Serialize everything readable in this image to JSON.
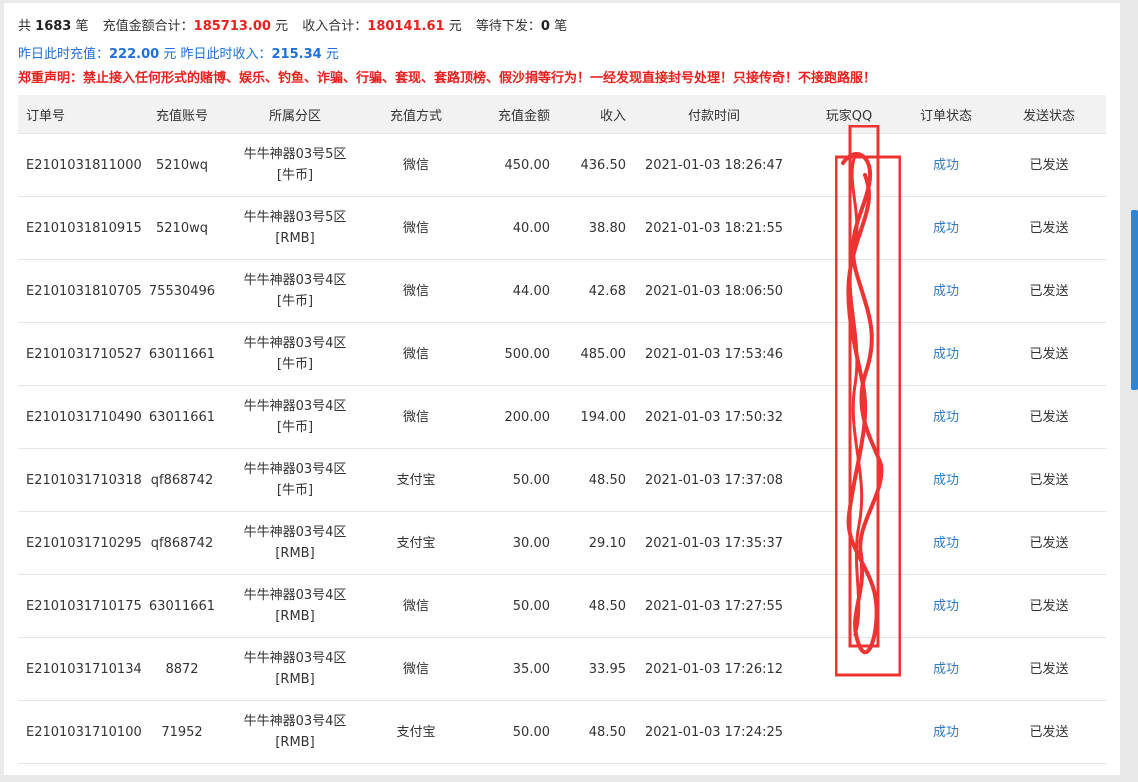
{
  "summary": {
    "total_prefix": "共",
    "total_count": "1683",
    "total_unit": "笔",
    "recharge_label": "充值金额合计：",
    "recharge_total": "185713.00",
    "recharge_unit": "元",
    "income_label": "收入合计：",
    "income_total": "180141.61",
    "income_unit": "元",
    "pending_label": "等待下发：",
    "pending_count": "0",
    "pending_unit": "笔"
  },
  "yesterday": {
    "recharge_label": "昨日此时充值：",
    "recharge_value": "222.00",
    "recharge_unit": "元",
    "income_label": "昨日此时收入：",
    "income_value": "215.34",
    "income_unit": "元"
  },
  "notice": "郑重声明：禁止接入任何形式的赌博、娱乐、钓鱼、诈骗、行骗、套现、套路顶榜、假沙捐等行为！一经发现直接封号处理！只接传奇！不接跑路服！",
  "table": {
    "headers": {
      "order": "订单号",
      "account": "充值账号",
      "zone": "所属分区",
      "method": "充值方式",
      "amount": "充值金额",
      "income": "收入",
      "paytime": "付款时间",
      "qq": "玩家QQ",
      "order_status": "订单状态",
      "send_status": "发送状态"
    },
    "rows": [
      {
        "order": "E2101031811000",
        "account": "5210wq",
        "zone": "牛牛神器03号5区[牛币]",
        "method": "微信",
        "amount": "450.00",
        "income": "436.50",
        "paytime": "2021-01-03 18:26:47",
        "qq": "",
        "order_status": "成功",
        "send_status": "已发送"
      },
      {
        "order": "E2101031810915",
        "account": "5210wq",
        "zone": "牛牛神器03号5区[RMB]",
        "method": "微信",
        "amount": "40.00",
        "income": "38.80",
        "paytime": "2021-01-03 18:21:55",
        "qq": "",
        "order_status": "成功",
        "send_status": "已发送"
      },
      {
        "order": "E2101031810705",
        "account": "75530496",
        "zone": "牛牛神器03号4区[牛币]",
        "method": "微信",
        "amount": "44.00",
        "income": "42.68",
        "paytime": "2021-01-03 18:06:50",
        "qq": "",
        "order_status": "成功",
        "send_status": "已发送"
      },
      {
        "order": "E2101031710527",
        "account": "63011661",
        "zone": "牛牛神器03号4区[牛币]",
        "method": "微信",
        "amount": "500.00",
        "income": "485.00",
        "paytime": "2021-01-03 17:53:46",
        "qq": "",
        "order_status": "成功",
        "send_status": "已发送"
      },
      {
        "order": "E2101031710490",
        "account": "63011661",
        "zone": "牛牛神器03号4区[牛币]",
        "method": "微信",
        "amount": "200.00",
        "income": "194.00",
        "paytime": "2021-01-03 17:50:32",
        "qq": "",
        "order_status": "成功",
        "send_status": "已发送"
      },
      {
        "order": "E2101031710318",
        "account": "qf868742",
        "zone": "牛牛神器03号4区[牛币]",
        "method": "支付宝",
        "amount": "50.00",
        "income": "48.50",
        "paytime": "2021-01-03 17:37:08",
        "qq": "",
        "order_status": "成功",
        "send_status": "已发送"
      },
      {
        "order": "E2101031710295",
        "account": "qf868742",
        "zone": "牛牛神器03号4区[RMB]",
        "method": "支付宝",
        "amount": "30.00",
        "income": "29.10",
        "paytime": "2021-01-03 17:35:37",
        "qq": "",
        "order_status": "成功",
        "send_status": "已发送"
      },
      {
        "order": "E2101031710175",
        "account": "63011661",
        "zone": "牛牛神器03号4区[RMB]",
        "method": "微信",
        "amount": "50.00",
        "income": "48.50",
        "paytime": "2021-01-03 17:27:55",
        "qq": "",
        "order_status": "成功",
        "send_status": "已发送"
      },
      {
        "order": "E2101031710134",
        "account": "8872",
        "zone": "牛牛神器03号4区[RMB]",
        "method": "微信",
        "amount": "35.00",
        "income": "33.95",
        "paytime": "2021-01-03 17:26:12",
        "qq": "",
        "order_status": "成功",
        "send_status": "已发送"
      },
      {
        "order": "E2101031710100",
        "account": "71952",
        "zone": "牛牛神器03号4区[RMB]",
        "method": "支付宝",
        "amount": "50.00",
        "income": "48.50",
        "paytime": "2021-01-03 17:24:25",
        "qq": "",
        "order_status": "成功",
        "send_status": "已发送"
      }
    ]
  },
  "colors": {
    "accent_blue": "#1e6fd9",
    "link_blue": "#2e7bc4",
    "warning_red": "#e8211f",
    "header_bg": "#f2f2f2",
    "scroll_blue": "#2b86d8"
  }
}
